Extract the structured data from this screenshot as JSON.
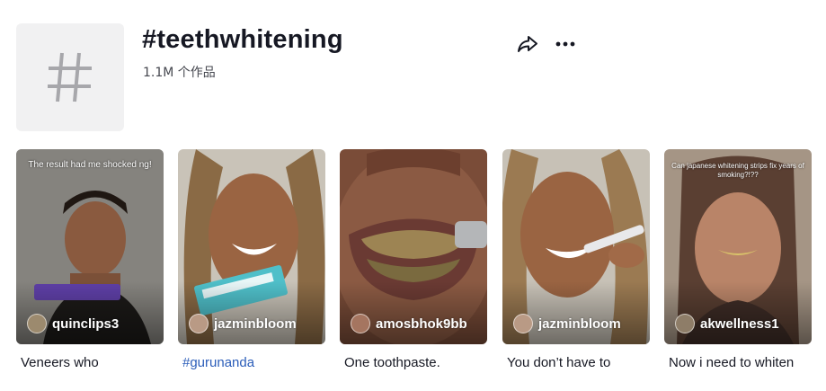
{
  "header": {
    "icon": "hashtag-icon",
    "title": "#teethwhitening",
    "count_text": "1.1M 个作品",
    "share_icon": "share-icon",
    "more_icon": "more-icon"
  },
  "videos": [
    {
      "overlay": "The result had me shocked ng!",
      "author": "quinclips3",
      "caption": "Veneers who",
      "caption_is_link": false
    },
    {
      "overlay": "",
      "author": "jazminbloom",
      "caption": "#gurunanda",
      "caption_is_link": true
    },
    {
      "overlay": "",
      "author": "amosbhok9bb",
      "caption": "One toothpaste.",
      "caption_is_link": false
    },
    {
      "overlay": "",
      "author": "jazminbloom",
      "caption": "You don’t have to",
      "caption_is_link": false
    },
    {
      "overlay": "Can japanese whitening strips fix years of smoking?!??",
      "author": "akwellness1",
      "caption": "Now i need to whiten",
      "caption_is_link": false
    }
  ],
  "colors": {
    "text": "#161823",
    "link": "#2b5db9",
    "muted": "#45474f",
    "avatar_bg": "#f1f1f2"
  }
}
